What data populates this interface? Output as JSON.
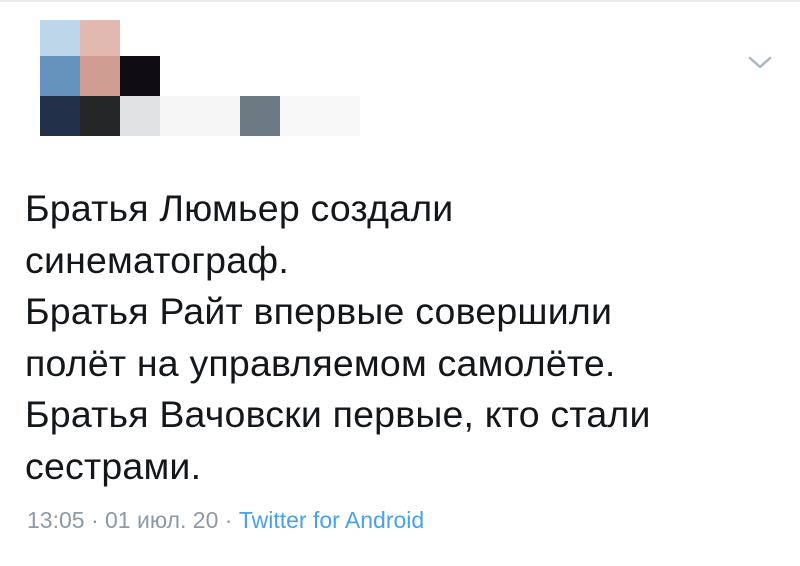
{
  "tweet": {
    "text_lines": [
      "Братья Люмьер создали",
      "синематограф.",
      "Братья Райт впервые совершили",
      "полёт на управляемом самолёте.",
      "Братья Вачовски первые, кто стали",
      "сестрами."
    ],
    "time": "13:05",
    "separator": " · ",
    "date": "01 июл. 20",
    "source": "Twitter for Android"
  },
  "icons": {
    "menu": "chevron-down-icon"
  },
  "colors": {
    "text": "#14171a",
    "meta": "#8c9aa6",
    "link": "#4aa1e8"
  }
}
